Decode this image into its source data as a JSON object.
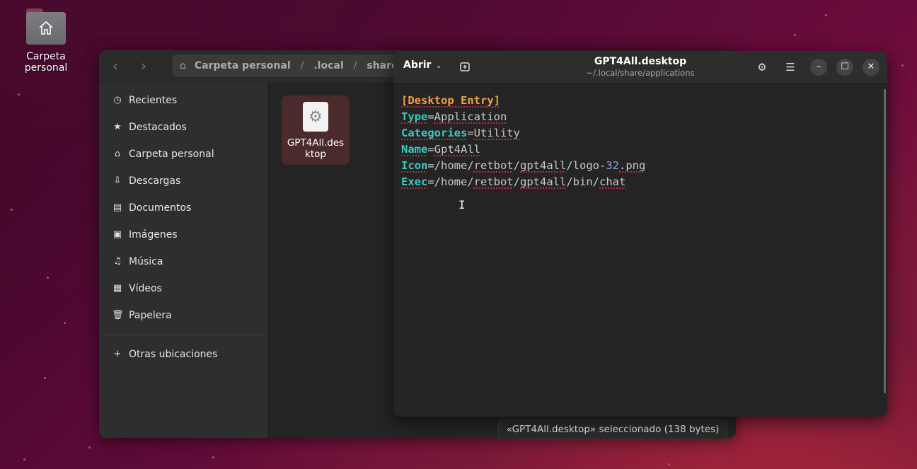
{
  "desktop": {
    "icon_label": "Carpeta personal"
  },
  "file_manager": {
    "path": [
      "Carpeta personal",
      ".local",
      "share"
    ],
    "sidebar": [
      {
        "label": "Recientes",
        "icon": "clock-icon"
      },
      {
        "label": "Destacados",
        "icon": "star-icon"
      },
      {
        "label": "Carpeta personal",
        "icon": "home-icon"
      },
      {
        "label": "Descargas",
        "icon": "download-icon"
      },
      {
        "label": "Documentos",
        "icon": "document-icon"
      },
      {
        "label": "Imágenes",
        "icon": "image-icon"
      },
      {
        "label": "Música",
        "icon": "music-icon"
      },
      {
        "label": "Vídeos",
        "icon": "video-icon"
      },
      {
        "label": "Papelera",
        "icon": "trash-icon"
      }
    ],
    "other_locations": "Otras ubicaciones",
    "file": {
      "name": "GPT4All.desktop",
      "display_name": "GPT4All.des\nktop"
    },
    "status": "«GPT4All.desktop» seleccionado  (138 bytes)"
  },
  "editor": {
    "open_label": "Abrir",
    "title": "GPT4All.desktop",
    "subtitle": "~/.local/share/applications",
    "lines": {
      "l1": "[Desktop Entry]",
      "l2_key": "Type",
      "l2_val": "Application",
      "l3_key": "Categories",
      "l3_val": "Utility",
      "l4_key": "Name",
      "l4_val": "Gpt4All",
      "l5_key": "Icon",
      "l5_a": "/home/",
      "l5_b": "retbot",
      "l5_c": "/",
      "l5_d": "gpt4all",
      "l5_e": "/logo-",
      "l5_num": "32",
      "l5_f": ".png",
      "l6_key": "Exec",
      "l6_a": "/home/",
      "l6_b": "retbot",
      "l6_c": "/",
      "l6_d": "gpt4all",
      "l6_e": "/bin/",
      "l6_f": "chat"
    }
  },
  "colors": {
    "accent_key": "#3fc8c0",
    "header_text": "#f0a040",
    "spell_underline": "#e0334a"
  }
}
